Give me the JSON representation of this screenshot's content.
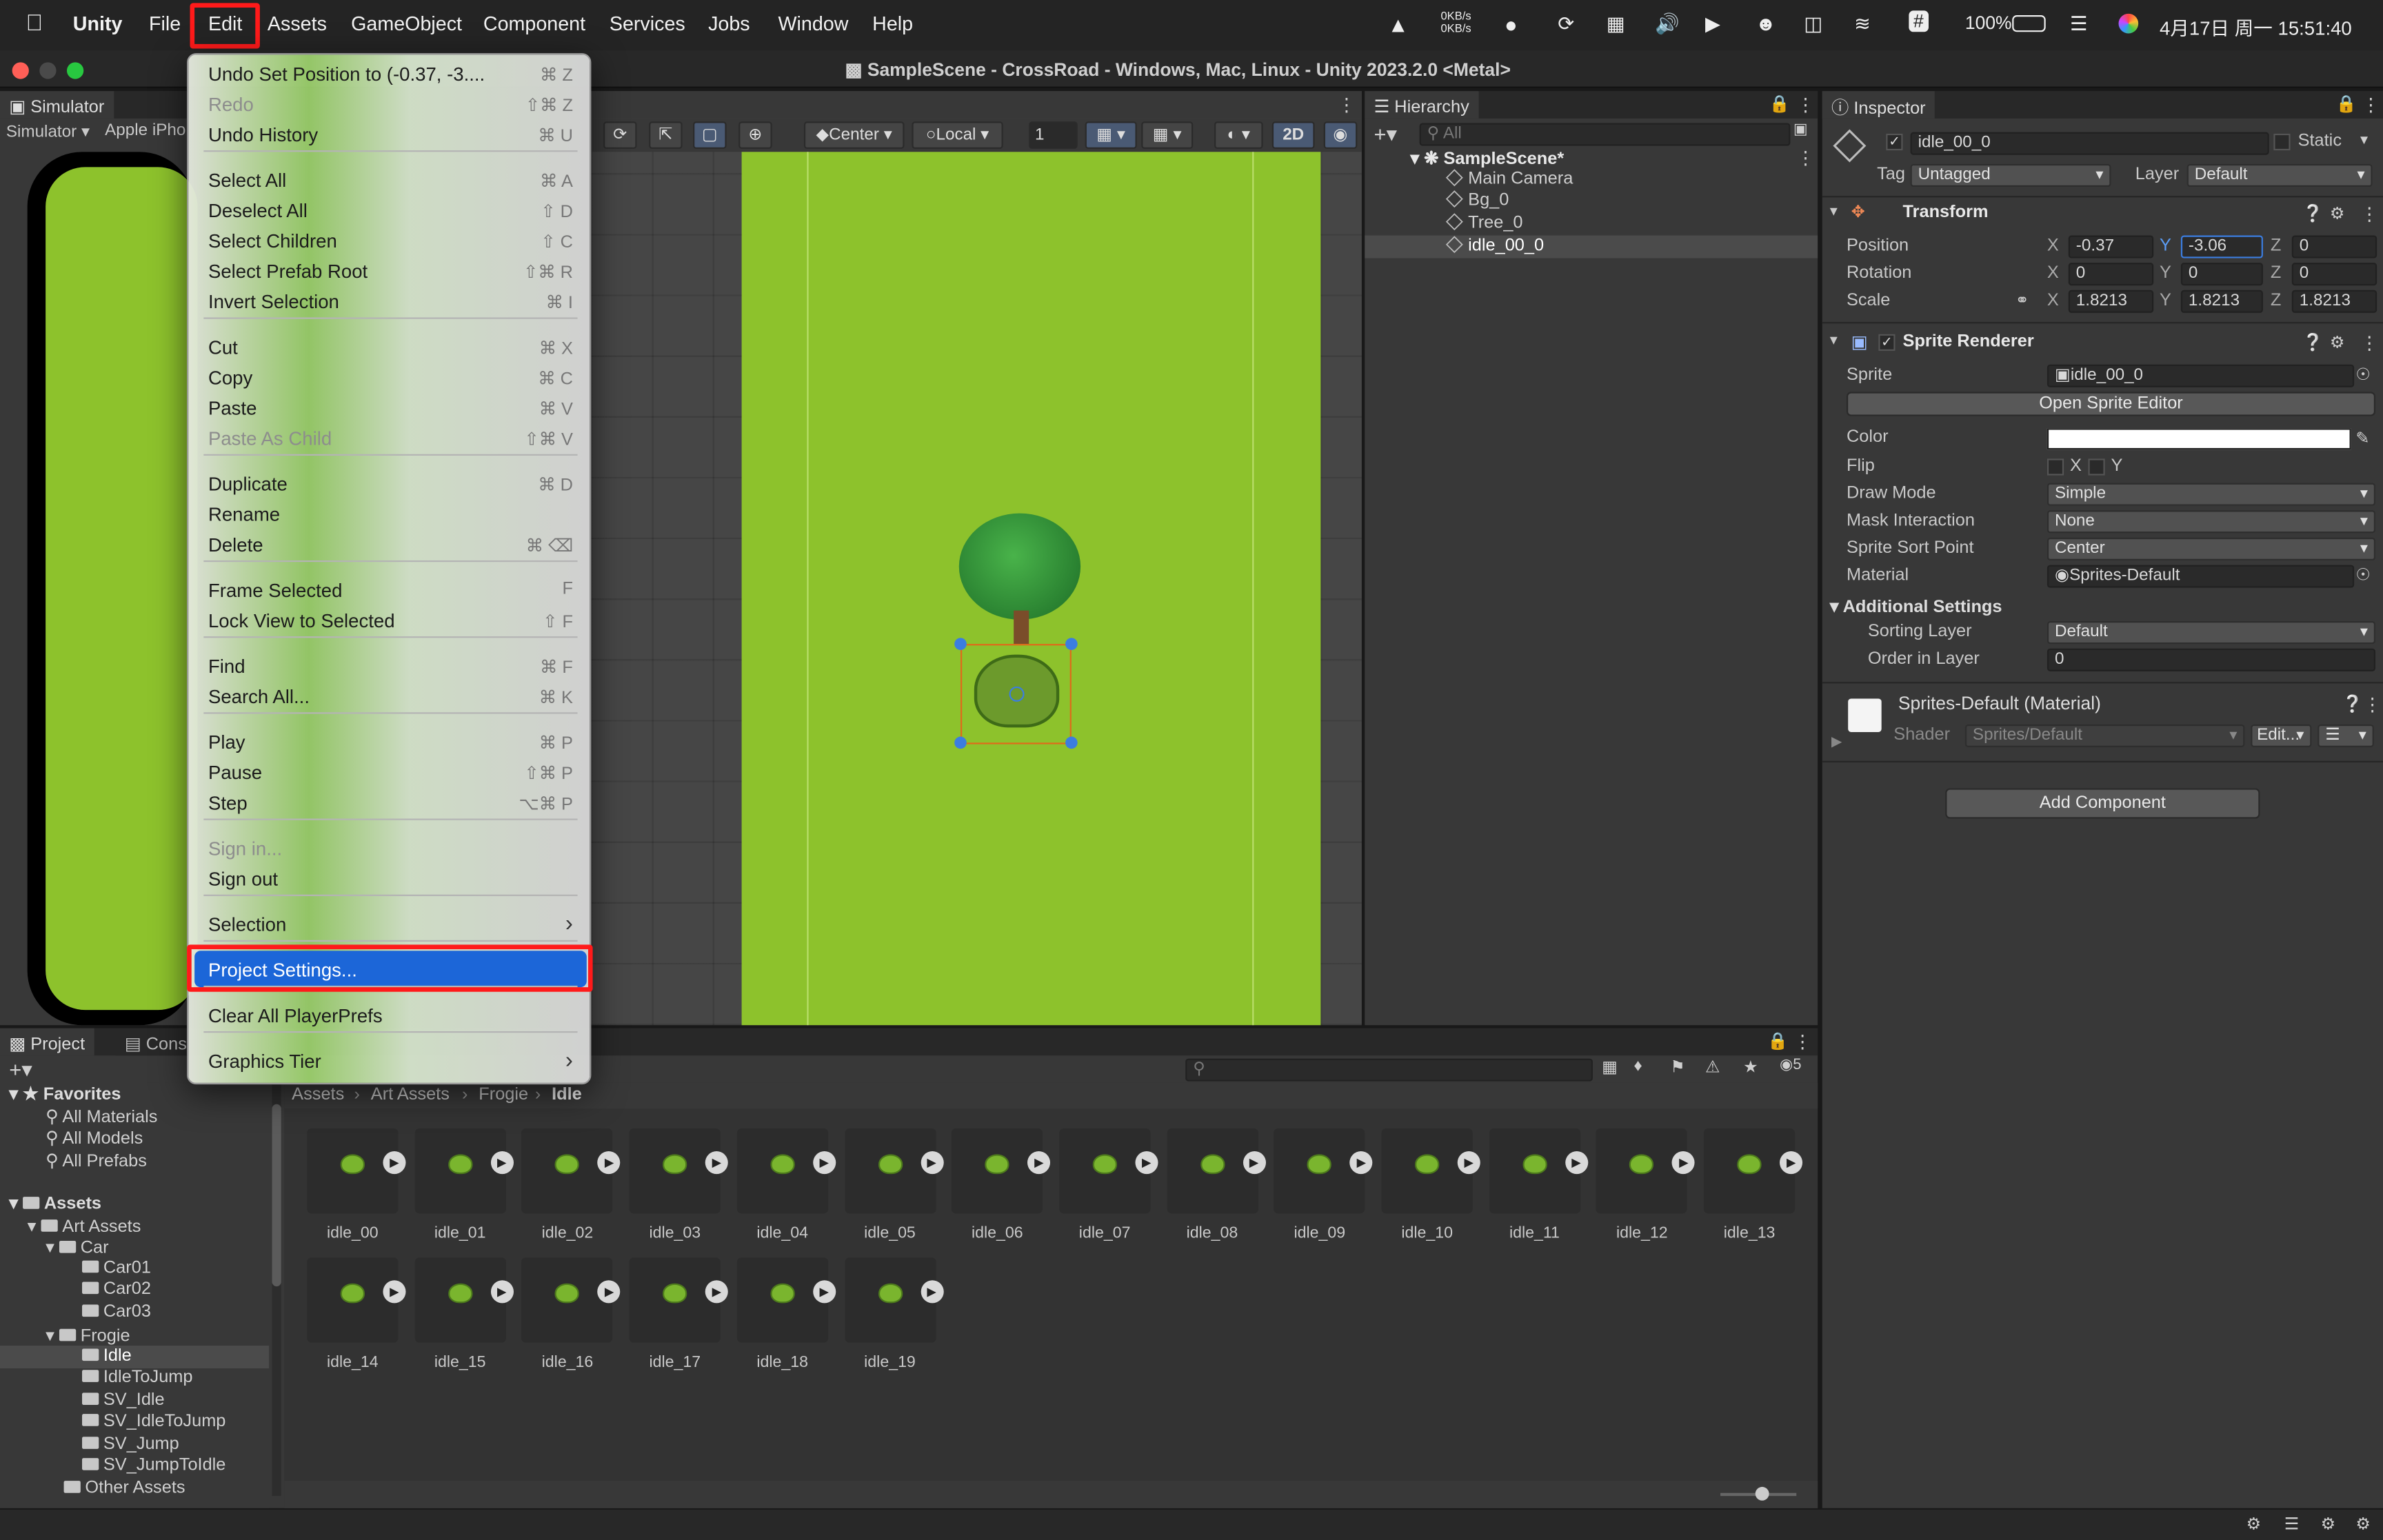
{
  "macbar": {
    "app": "Unity",
    "menus": [
      "File",
      "Edit",
      "Assets",
      "GameObject",
      "Component",
      "Services",
      "Jobs",
      "Window",
      "Help"
    ],
    "highlighted_menu": "Edit",
    "net_up": "0KB/s",
    "net_down": "0KB/s",
    "battery": "100%",
    "clock": "4月17日 周一  15:51:40"
  },
  "window_title": "SampleScene - CrossRoad - Windows, Mac, Linux - Unity 2023.2.0 <Metal>",
  "edit_menu": {
    "items": [
      {
        "label": "Undo Set Position to (-0.37, -3....",
        "shortcut": "⌘ Z"
      },
      {
        "label": "Redo",
        "shortcut": "⇧⌘ Z",
        "disabled": true
      },
      {
        "label": "Undo History",
        "shortcut": "⌘ U"
      },
      {
        "label": "Select All",
        "shortcut": "⌘ A"
      },
      {
        "label": "Deselect All",
        "shortcut": "⇧ D"
      },
      {
        "label": "Select Children",
        "shortcut": "⇧ C"
      },
      {
        "label": "Select Prefab Root",
        "shortcut": "⇧⌘ R"
      },
      {
        "label": "Invert Selection",
        "shortcut": "⌘ I"
      },
      {
        "label": "Cut",
        "shortcut": "⌘ X"
      },
      {
        "label": "Copy",
        "shortcut": "⌘ C"
      },
      {
        "label": "Paste",
        "shortcut": "⌘ V"
      },
      {
        "label": "Paste As Child",
        "shortcut": "⇧⌘ V",
        "disabled": true
      },
      {
        "label": "Duplicate",
        "shortcut": "⌘ D"
      },
      {
        "label": "Rename",
        "shortcut": ""
      },
      {
        "label": "Delete",
        "shortcut": "⌘ ⌫"
      },
      {
        "label": "Frame Selected",
        "shortcut": "F"
      },
      {
        "label": "Lock View to Selected",
        "shortcut": "⇧ F"
      },
      {
        "label": "Find",
        "shortcut": "⌘ F"
      },
      {
        "label": "Search All...",
        "shortcut": "⌘ K"
      },
      {
        "label": "Play",
        "shortcut": "⌘ P"
      },
      {
        "label": "Pause",
        "shortcut": "⇧⌘ P"
      },
      {
        "label": "Step",
        "shortcut": "⌥⌘ P"
      },
      {
        "label": "Sign in...",
        "shortcut": "",
        "disabled": true
      },
      {
        "label": "Sign out",
        "shortcut": ""
      },
      {
        "label": "Selection",
        "shortcut": "›"
      },
      {
        "label": "Project Settings...",
        "shortcut": "",
        "highlighted": true
      },
      {
        "label": "Clear All PlayerPrefs",
        "shortcut": ""
      },
      {
        "label": "Graphics Tier",
        "shortcut": "›"
      }
    ]
  },
  "simulator": {
    "tab": "Simulator",
    "mode": "Simulator",
    "device": "Apple iPho"
  },
  "scene_toolbar": {
    "pivot": "Center",
    "space": "Local",
    "grid_value": "1",
    "mode_2d": "2D"
  },
  "hierarchy": {
    "tab": "Hierarchy",
    "search_placeholder": "All",
    "scene": "SampleScene*",
    "items": [
      "Main Camera",
      "Bg_0",
      "Tree_0",
      "idle_00_0"
    ],
    "selected": "idle_00_0"
  },
  "inspector": {
    "tab": "Inspector",
    "object_name": "idle_00_0",
    "static_label": "Static",
    "tag_label": "Tag",
    "tag": "Untagged",
    "layer_label": "Layer",
    "layer": "Default",
    "transform": {
      "title": "Transform",
      "position_label": "Position",
      "rotation_label": "Rotation",
      "scale_label": "Scale",
      "position": {
        "x": "-0.37",
        "y": "-3.06",
        "z": "0"
      },
      "rotation": {
        "x": "0",
        "y": "0",
        "z": "0"
      },
      "scale": {
        "x": "1.8213",
        "y": "1.8213",
        "z": "1.8213"
      }
    },
    "sprite_renderer": {
      "title": "Sprite Renderer",
      "sprite_label": "Sprite",
      "sprite": "idle_00_0",
      "open_editor": "Open Sprite Editor",
      "color_label": "Color",
      "flip_label": "Flip",
      "flip_x": "X",
      "flip_y": "Y",
      "draw_mode_label": "Draw Mode",
      "draw_mode": "Simple",
      "mask_label": "Mask Interaction",
      "mask": "None",
      "sort_point_label": "Sprite Sort Point",
      "sort_point": "Center",
      "material_label": "Material",
      "material": "Sprites-Default",
      "additional": "Additional Settings",
      "sorting_layer_label": "Sorting Layer",
      "sorting_layer": "Default",
      "order_label": "Order in Layer",
      "order": "0"
    },
    "material_block": {
      "title": "Sprites-Default (Material)",
      "shader_label": "Shader",
      "shader": "Sprites/Default",
      "edit": "Edit..."
    },
    "add_component": "Add Component"
  },
  "project": {
    "tab_project": "Project",
    "tab_console": "Cons",
    "breadcrumb": [
      "Assets",
      "Art Assets",
      "Frogie",
      "Idle"
    ],
    "hidden_count": "5",
    "favorites": {
      "title": "Favorites",
      "items": [
        "All Materials",
        "All Models",
        "All Prefabs"
      ]
    },
    "assets_root": "Assets",
    "tree": [
      {
        "label": "Art Assets",
        "depth": 1
      },
      {
        "label": "Car",
        "depth": 2
      },
      {
        "label": "Car01",
        "depth": 3
      },
      {
        "label": "Car02",
        "depth": 3
      },
      {
        "label": "Car03",
        "depth": 3
      },
      {
        "label": "Frogie",
        "depth": 2
      },
      {
        "label": "Idle",
        "depth": 3,
        "selected": true
      },
      {
        "label": "IdleToJump",
        "depth": 3
      },
      {
        "label": "SV_Idle",
        "depth": 3
      },
      {
        "label": "SV_IdleToJump",
        "depth": 3
      },
      {
        "label": "SV_Jump",
        "depth": 3
      },
      {
        "label": "SV_JumpToIdle",
        "depth": 3
      },
      {
        "label": "Other Assets",
        "depth": 2
      }
    ],
    "files": [
      "idle_00",
      "idle_01",
      "idle_02",
      "idle_03",
      "idle_04",
      "idle_05",
      "idle_06",
      "idle_07",
      "idle_08",
      "idle_09",
      "idle_10",
      "idle_11",
      "idle_12",
      "idle_13",
      "idle_14",
      "idle_15",
      "idle_16",
      "idle_17",
      "idle_18",
      "idle_19"
    ]
  },
  "colors": {
    "accent": "#1c66d8",
    "highlight_box": "#ff1a1a",
    "scene_green": "#8dc22c"
  }
}
